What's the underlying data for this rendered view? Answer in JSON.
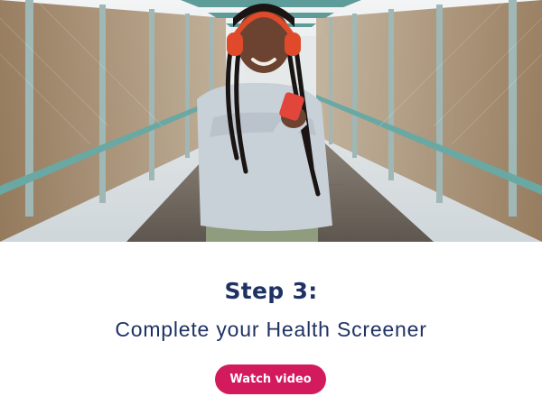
{
  "hero": {
    "image_description_icon": "person-with-headphones-image"
  },
  "step": {
    "title": "Step 3:",
    "subtitle": "Complete your Health Screener"
  },
  "cta": {
    "label": "Watch video"
  },
  "colors": {
    "heading": "#1f3264",
    "button": "#d21a5c",
    "button_text": "#ffffff",
    "background": "#ffffff"
  }
}
